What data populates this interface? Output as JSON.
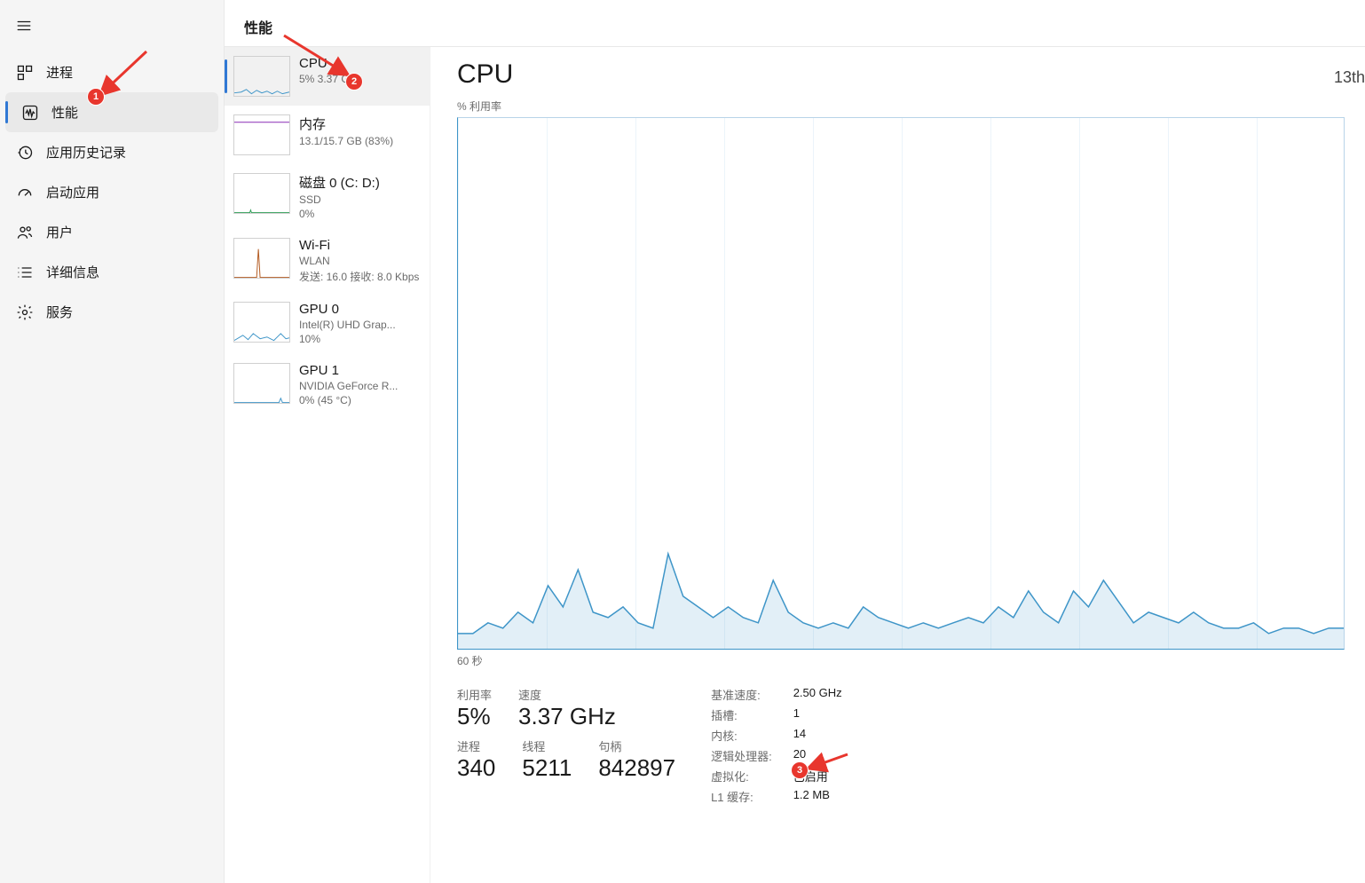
{
  "header": {
    "title": "性能"
  },
  "nav": {
    "items": [
      {
        "label": "进程"
      },
      {
        "label": "性能"
      },
      {
        "label": "应用历史记录"
      },
      {
        "label": "启动应用"
      },
      {
        "label": "用户"
      },
      {
        "label": "详细信息"
      },
      {
        "label": "服务"
      }
    ]
  },
  "perf_list": {
    "cpu": {
      "title": "CPU",
      "sub1": "5% 3.37 GHz"
    },
    "mem": {
      "title": "内存",
      "sub1": "13.1/15.7 GB (83%)"
    },
    "disk": {
      "title": "磁盘 0 (C: D:)",
      "sub1": "SSD",
      "sub2": "0%"
    },
    "wifi": {
      "title": "Wi-Fi",
      "sub1": "WLAN",
      "sub2": "发送: 16.0 接收: 8.0 Kbps"
    },
    "gpu0": {
      "title": "GPU 0",
      "sub1": "Intel(R) UHD Grap...",
      "sub2": "10%"
    },
    "gpu1": {
      "title": "GPU 1",
      "sub1": "NVIDIA GeForce R...",
      "sub2": "0% (45 °C)"
    }
  },
  "detail": {
    "title": "CPU",
    "model_cut": "13th",
    "chart_top_label": "% 利用率",
    "chart_bottom_label": "60 秒"
  },
  "stats1": {
    "util_label": "利用率",
    "util_value": "5%",
    "speed_label": "速度",
    "speed_value": "3.37 GHz"
  },
  "stats2": {
    "proc_label": "进程",
    "proc_value": "340",
    "thread_label": "线程",
    "thread_value": "5211",
    "handle_label": "句柄",
    "handle_value": "842897"
  },
  "specs": {
    "base_label": "基准速度:",
    "base_value": "2.50 GHz",
    "sockets_label": "插槽:",
    "sockets_value": "1",
    "cores_label": "内核:",
    "cores_value": "14",
    "lprocs_label": "逻辑处理器:",
    "lprocs_value": "20",
    "virt_label": "虚拟化:",
    "virt_value": "已启用",
    "l1_label": "L1 缓存:",
    "l1_value": "1.2 MB"
  },
  "annotations": {
    "b1": "1",
    "b2": "2",
    "b3": "3"
  },
  "chart_data": {
    "type": "line",
    "xlabel": "60 秒",
    "ylabel": "% 利用率",
    "ylim": [
      0,
      100
    ],
    "series": [
      {
        "name": "CPU 利用率",
        "values": [
          3,
          3,
          5,
          4,
          7,
          5,
          12,
          8,
          15,
          7,
          6,
          8,
          5,
          4,
          18,
          10,
          8,
          6,
          8,
          6,
          5,
          13,
          7,
          5,
          4,
          5,
          4,
          8,
          6,
          5,
          4,
          5,
          4,
          5,
          6,
          5,
          8,
          6,
          11,
          7,
          5,
          11,
          8,
          13,
          9,
          5,
          7,
          6,
          5,
          7,
          5,
          4,
          4,
          5,
          3,
          4,
          4,
          3,
          4,
          4
        ]
      }
    ]
  }
}
